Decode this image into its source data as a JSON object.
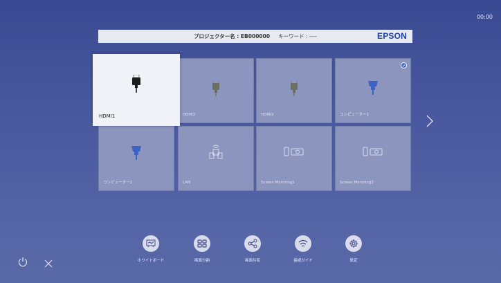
{
  "clock": "00:00",
  "header": {
    "projector_name": "プロジェクター名 : EB000000",
    "keyword": "キーワード : ----",
    "logo": "EPSON"
  },
  "sources": [
    {
      "label": "HDMI1",
      "icon": "hdmi-icon",
      "selected": true
    },
    {
      "label": "HDMI2",
      "icon": "hdmi-icon"
    },
    {
      "label": "HDMI3",
      "icon": "hdmi-icon"
    },
    {
      "label": "コンピューター1",
      "icon": "vga-icon",
      "checked": true
    },
    {
      "label": "コンピューター2",
      "icon": "vga-icon"
    },
    {
      "label": "LAN",
      "icon": "lan-icon"
    },
    {
      "label": "Screen Mirroring1",
      "icon": "mirroring-icon"
    },
    {
      "label": "Screen Mirroring2",
      "icon": "mirroring-icon"
    }
  ],
  "bottom_menu": [
    {
      "label": "ホワイトボード",
      "icon": "whiteboard-icon"
    },
    {
      "label": "画面分割",
      "icon": "split-screen-icon"
    },
    {
      "label": "画面共有",
      "icon": "share-icon"
    },
    {
      "label": "接続ガイド",
      "icon": "wifi-icon"
    },
    {
      "label": "設定",
      "icon": "gear-icon"
    }
  ],
  "colors": {
    "accent": "#1a3fa6",
    "tile": "#8c95bd",
    "selected_tile": "#f1f2f8",
    "vga_blue": "#3d63c4"
  }
}
